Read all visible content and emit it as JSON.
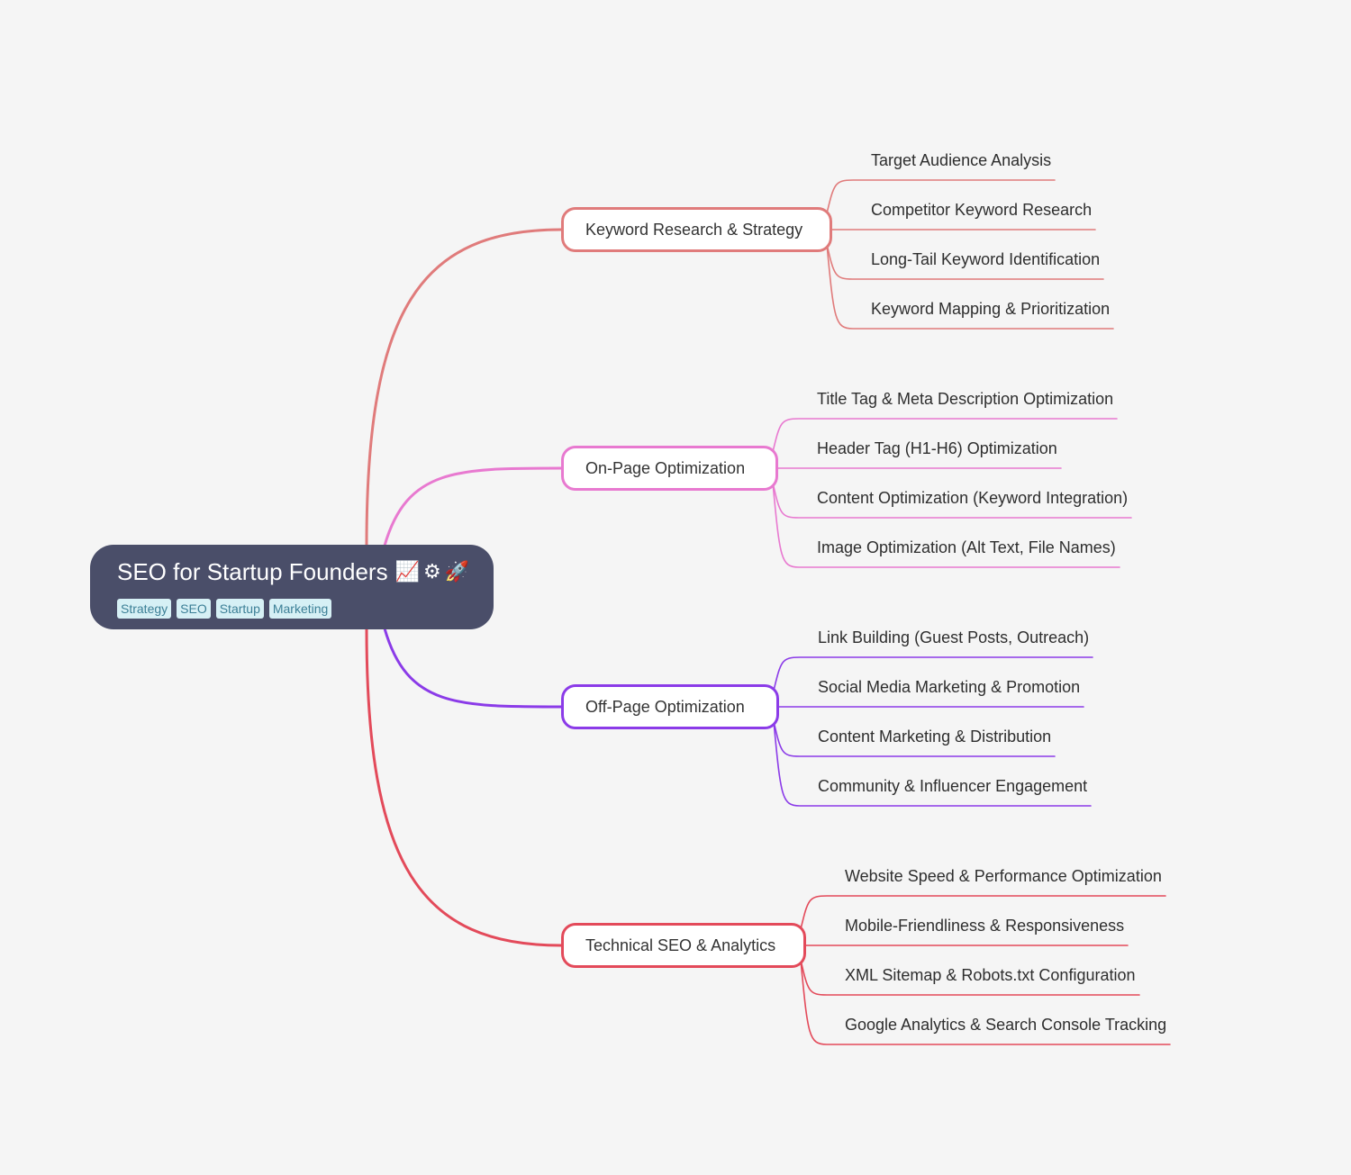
{
  "root": {
    "title": "SEO for Startup Founders",
    "emojis": [
      "📈",
      "⚙",
      "🚀"
    ],
    "emoji_icons": [
      "chart-increasing-icon",
      "gear-icon",
      "rocket-icon"
    ],
    "tags": [
      "Strategy",
      "SEO",
      "Startup",
      "Marketing"
    ],
    "background_color": "#4a4e69",
    "tag_background": "#d6f0f5",
    "tag_text_color": "#3c7f96"
  },
  "branches": [
    {
      "label": "Keyword Research & Strategy",
      "color": "#e07b7b",
      "children": [
        "Target Audience Analysis",
        "Competitor Keyword Research",
        "Long-Tail Keyword Identification",
        "Keyword Mapping & Prioritization"
      ]
    },
    {
      "label": "On-Page Optimization",
      "color": "#e879d0",
      "children": [
        "Title Tag & Meta Description Optimization",
        "Header Tag (H1-H6) Optimization",
        "Content Optimization (Keyword Integration)",
        "Image Optimization (Alt Text, File Names)"
      ]
    },
    {
      "label": "Off-Page Optimization",
      "color": "#8b3be8",
      "children": [
        "Link Building (Guest Posts, Outreach)",
        "Social Media Marketing & Promotion",
        "Content Marketing & Distribution",
        "Community & Influencer Engagement"
      ]
    },
    {
      "label": "Technical SEO & Analytics",
      "color": "#e34a5a",
      "children": [
        "Website Speed & Performance Optimization",
        "Mobile-Friendliness & Responsiveness",
        "XML Sitemap & Robots.txt Configuration",
        "Google Analytics & Search Console Tracking"
      ]
    }
  ]
}
